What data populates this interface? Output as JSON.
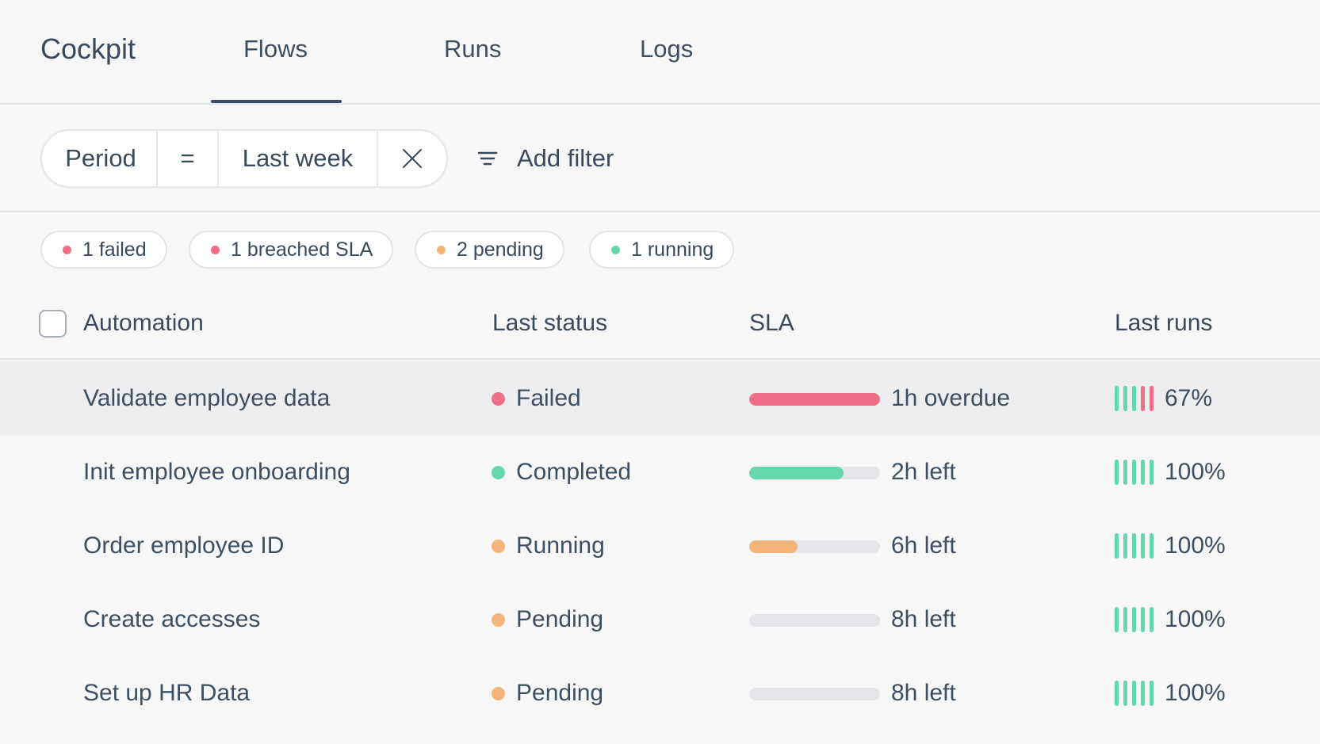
{
  "app": {
    "title": "Cockpit"
  },
  "nav": {
    "tabs": [
      {
        "label": "Flows",
        "active": true
      },
      {
        "label": "Runs",
        "active": false
      },
      {
        "label": "Logs",
        "active": false
      }
    ]
  },
  "filter": {
    "field": "Period",
    "operator": "=",
    "value": "Last week",
    "add_label": "Add filter"
  },
  "chips": [
    {
      "label": "1 failed",
      "color": "#ee6f86"
    },
    {
      "label": "1 breached SLA",
      "color": "#ee6f86"
    },
    {
      "label": "2 pending",
      "color": "#f5b57a"
    },
    {
      "label": "1 running",
      "color": "#66d6ad"
    }
  ],
  "table": {
    "headers": {
      "automation": "Automation",
      "status": "Last status",
      "sla": "SLA",
      "runs": "Last runs"
    },
    "rows": [
      {
        "name": "Validate employee data",
        "status": "Failed",
        "status_color": "#ee6f86",
        "sla_progress": 1.0,
        "sla_color": "#ee6f86",
        "sla_text": "1h overdue",
        "runs": [
          "ok",
          "ok",
          "ok",
          "fail",
          "fail"
        ],
        "runs_pct": "67%",
        "selected": true
      },
      {
        "name": "Init employee onboarding",
        "status": "Completed",
        "status_color": "#66d6ad",
        "sla_progress": 0.72,
        "sla_color": "#66d6ad",
        "sla_text": "2h left",
        "runs": [
          "ok",
          "ok",
          "ok",
          "ok",
          "ok"
        ],
        "runs_pct": "100%",
        "selected": false
      },
      {
        "name": "Order employee ID",
        "status": "Running",
        "status_color": "#f5b57a",
        "sla_progress": 0.37,
        "sla_color": "#f5b57a",
        "sla_text": "6h left",
        "runs": [
          "ok",
          "ok",
          "ok",
          "ok",
          "ok"
        ],
        "runs_pct": "100%",
        "selected": false
      },
      {
        "name": "Create accesses",
        "status": "Pending",
        "status_color": "#f5b57a",
        "sla_progress": 0,
        "sla_color": "#f5b57a",
        "sla_text": "8h left",
        "runs": [
          "ok",
          "ok",
          "ok",
          "ok",
          "ok"
        ],
        "runs_pct": "100%",
        "selected": false
      },
      {
        "name": "Set up HR Data",
        "status": "Pending",
        "status_color": "#f5b57a",
        "sla_progress": 0,
        "sla_color": "#f5b57a",
        "sla_text": "8h left",
        "runs": [
          "ok",
          "ok",
          "ok",
          "ok",
          "ok"
        ],
        "runs_pct": "100%",
        "selected": false
      }
    ]
  },
  "colors": {
    "ok": "#66d6ad",
    "fail": "#ee6f86",
    "text": "#3a4a5c"
  },
  "icons": {
    "clear_filter": "close-icon",
    "add_filter": "filter-lines-icon"
  }
}
